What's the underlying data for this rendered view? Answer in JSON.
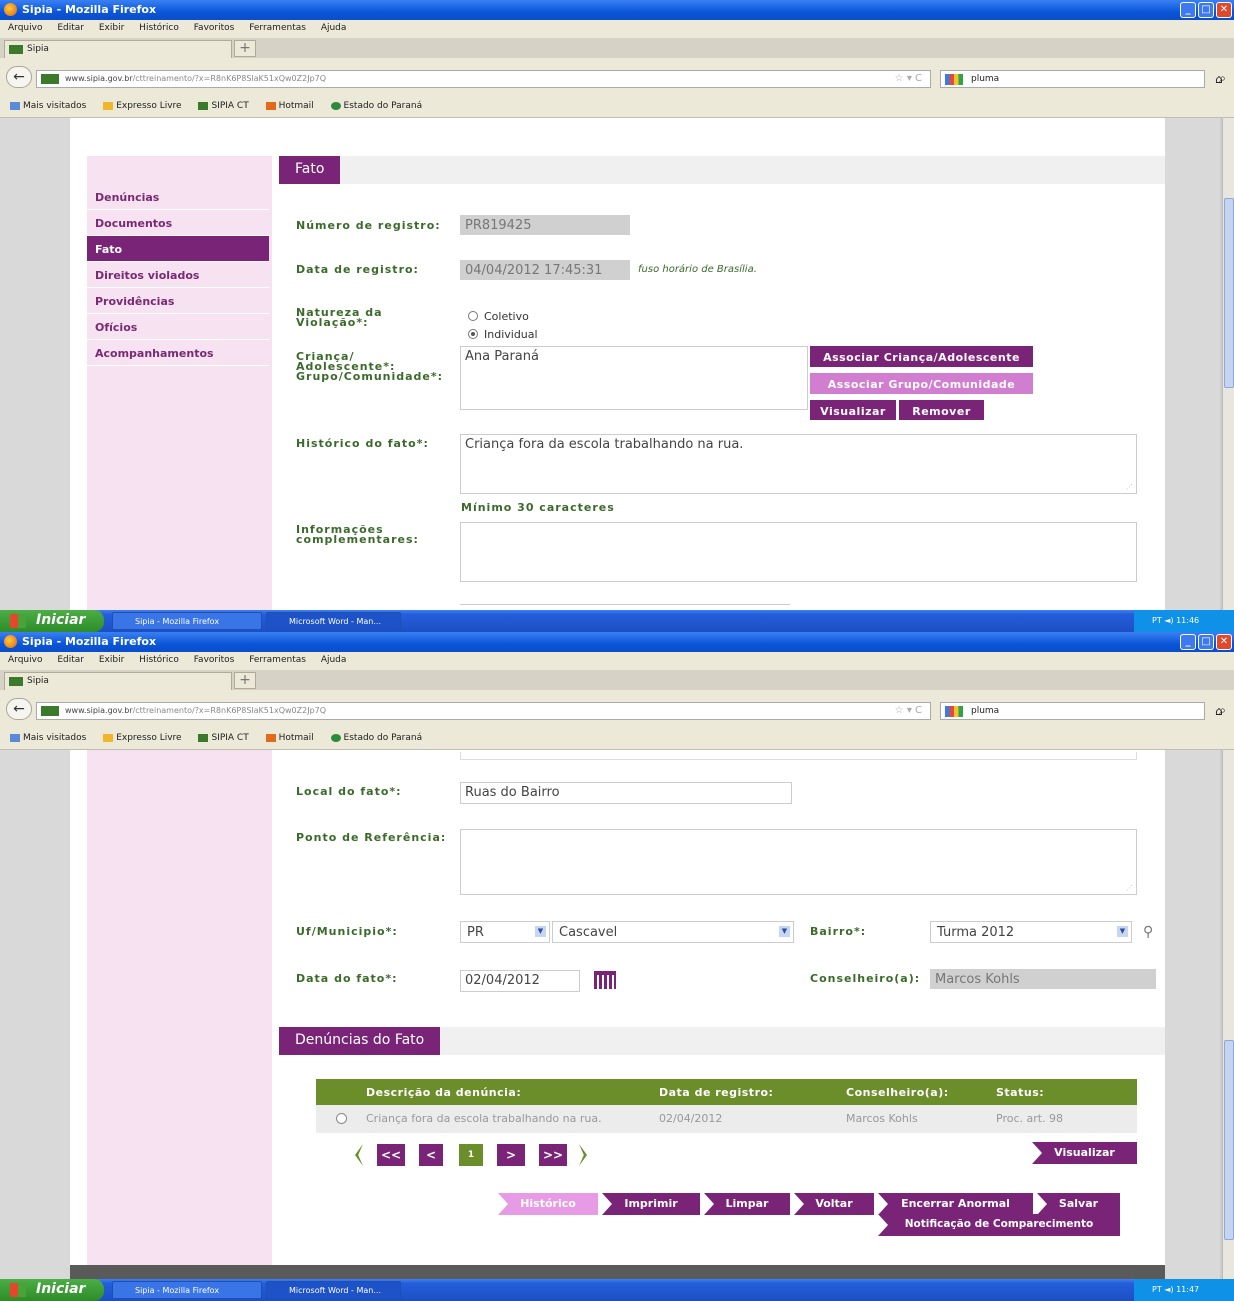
{
  "window": {
    "title": "Sipia - Mozilla Firefox",
    "menu": [
      "Arquivo",
      "Editar",
      "Exibir",
      "Histórico",
      "Favoritos",
      "Ferramentas",
      "Ajuda"
    ],
    "tab_label": "Sipia",
    "url_domain": "www.sipia.gov.br",
    "url_path": "/cttreinamento/?x=R8nK6P8SlaK51xQw0Z2Jp7Q",
    "search_value": "pluma",
    "bookmarks": [
      "Mais visitados",
      "Expresso Livre",
      "SIPIA CT",
      "Hotmail",
      "Estado do Paraná"
    ]
  },
  "sidebar": {
    "items": [
      "Denúncias",
      "Documentos",
      "Fato",
      "Direitos violados",
      "Providências",
      "Ofícios",
      "Acompanhamentos"
    ],
    "active_index": 2
  },
  "form": {
    "section_title": "Fato",
    "registro_label": "Número de registro:",
    "registro_value": "PR819425",
    "data_label": "Data de registro:",
    "data_value": "04/04/2012 17:45:31",
    "timezone_note": "fuso horário de Brasília.",
    "natureza_label": "Natureza da Violação*:",
    "natureza_options": [
      "Coletivo",
      "Individual"
    ],
    "natureza_selected": "Individual",
    "crianca_label": "Criança/ Adolescente*: Grupo/Comunidade*:",
    "crianca_value": "Ana Paraná",
    "btn_associar_crianca": "Associar Criança/Adolescente",
    "btn_associar_grupo": "Associar Grupo/Comunidade",
    "btn_visualizar": "Visualizar",
    "btn_remover": "Remover",
    "historico_label": "Histórico do fato*:",
    "historico_value": "Criança fora da escola trabalhando na rua.",
    "historico_hint": "Mínimo 30 caracteres",
    "info_label": "Informações complementares:",
    "info_value": "",
    "local_label": "Local do fato*:",
    "local_value": "Ruas do Bairro",
    "ponto_label": "Ponto de Referência:",
    "ponto_value": "",
    "uf_label": "Uf/Municipio*:",
    "uf_value": "PR",
    "municipio_value": "Cascavel",
    "bairro_label": "Bairro*:",
    "bairro_value": "Turma 2012",
    "data_fato_label": "Data do fato*:",
    "data_fato_value": "02/04/2012",
    "conselheiro_label": "Conselheiro(a):",
    "conselheiro_value": "Marcos Kohls"
  },
  "denuncias": {
    "section_title": "Denúncias do Fato",
    "columns": [
      "Descrição da denúncia:",
      "Data de registro:",
      "Conselheiro(a):",
      "Status:"
    ],
    "rows": [
      {
        "descricao": "Criança fora da escola trabalhando na rua.",
        "data": "02/04/2012",
        "conselheiro": "Marcos Kohls",
        "status": "Proc. art. 98"
      }
    ],
    "pager": {
      "first": "<<",
      "prev": "<",
      "current": "1",
      "next": ">",
      "last": ">>"
    },
    "btn_visualizar": "Visualizar"
  },
  "actions": {
    "historico": "Histórico",
    "imprimir": "Imprimir",
    "limpar": "Limpar",
    "voltar": "Voltar",
    "encerrar": "Encerrar Anormal",
    "salvar": "Salvar",
    "notificacao": "Notificação de Comparecimento"
  },
  "taskbar": {
    "start": "Iniciar",
    "items": [
      "Sipia - Mozilla Firefox",
      "Microsoft Word - Man..."
    ],
    "lang": "PT",
    "time1": "11:46",
    "time2": "11:47"
  },
  "colors": {
    "accent": "#7a2478",
    "green": "#6b8d2a",
    "sidebar_bg": "#f6e2f1"
  }
}
